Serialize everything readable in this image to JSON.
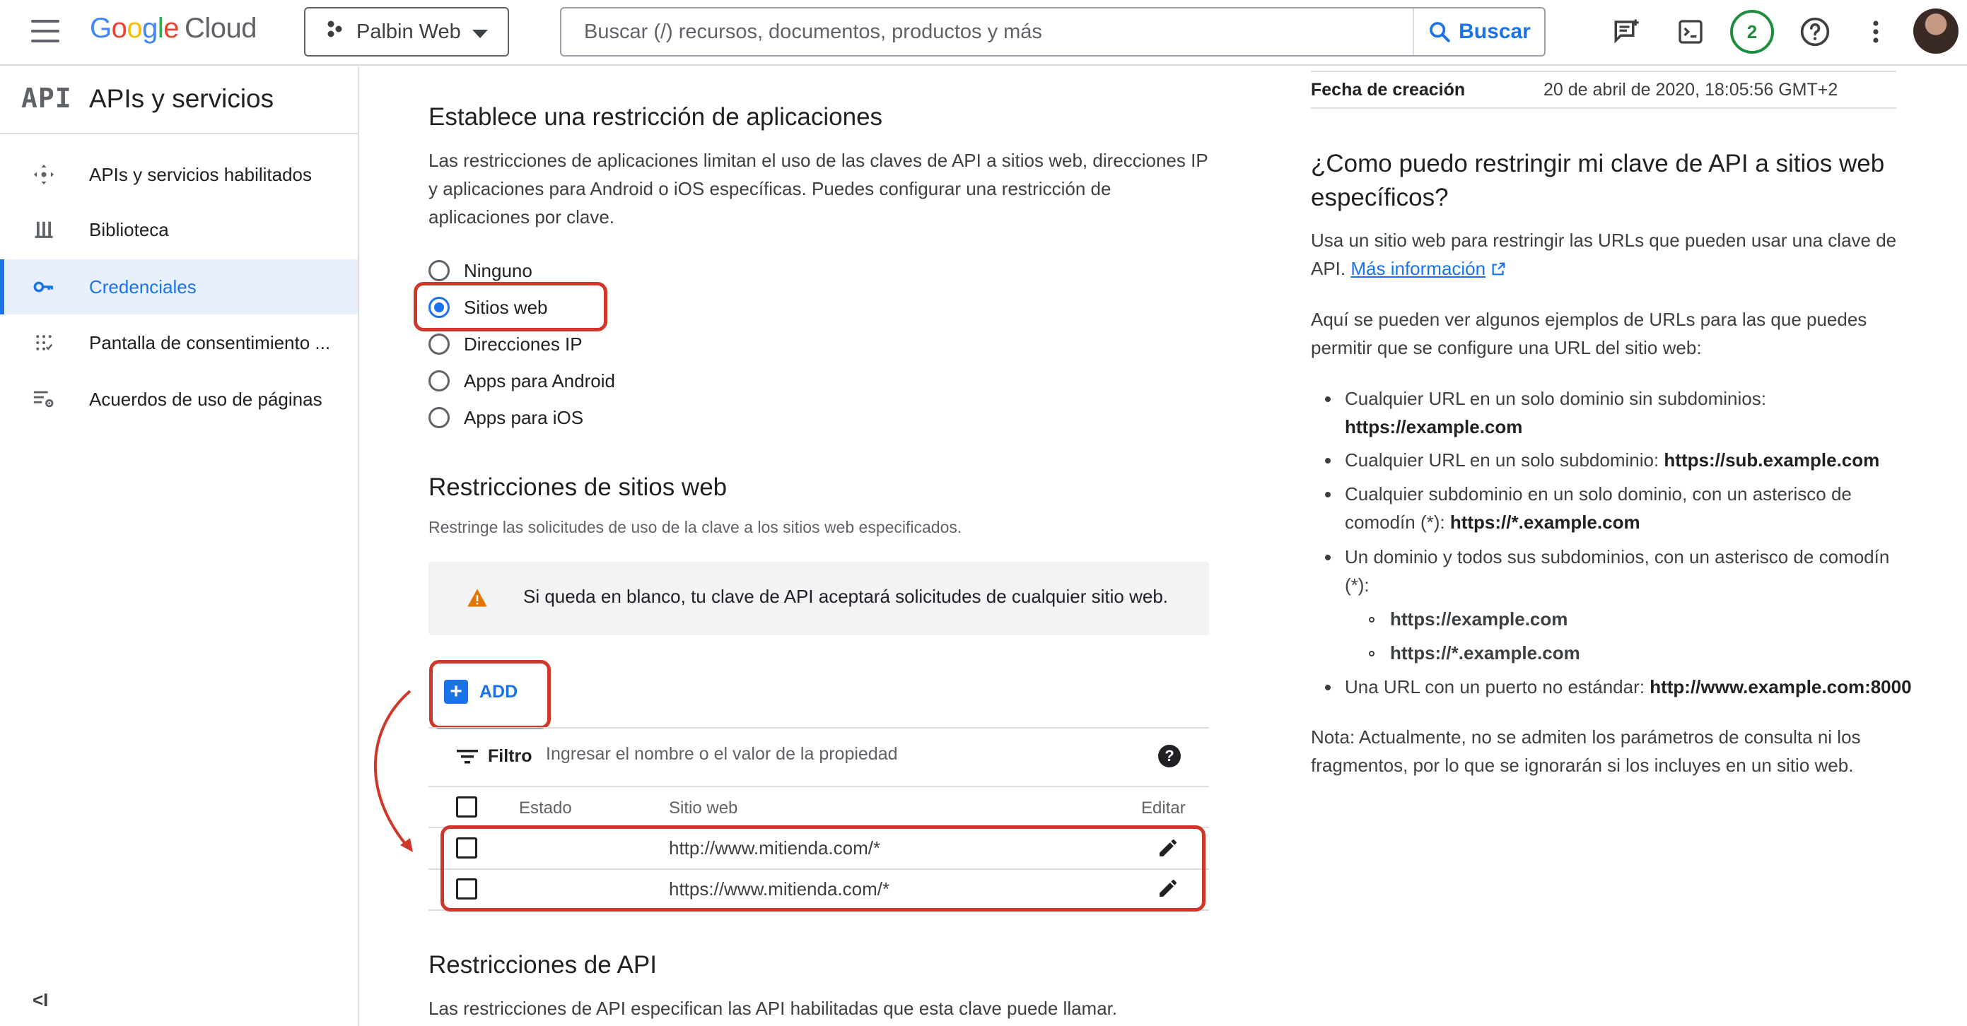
{
  "header": {
    "logo_google": "Google",
    "logo_cloud": "Cloud",
    "project": "Palbin Web",
    "search_placeholder": "Buscar (/) recursos, documentos, productos y más",
    "search_button": "Buscar",
    "notification_count": "2"
  },
  "sidebar": {
    "badge": "API",
    "title": "APIs y servicios",
    "items": [
      {
        "label": "APIs y servicios habilitados",
        "icon": "apis-hub-icon"
      },
      {
        "label": "Biblioteca",
        "icon": "library-icon"
      },
      {
        "label": "Credenciales",
        "icon": "key-icon",
        "active": true
      },
      {
        "label": "Pantalla de consentimiento ...",
        "icon": "consent-icon"
      },
      {
        "label": "Acuerdos de uso de páginas",
        "icon": "settings-list-icon"
      }
    ],
    "collapse": "<I"
  },
  "main": {
    "app_restriction_title": "Establece una restricción de aplicaciones",
    "app_restriction_desc": [
      "Las restricciones de aplicaciones limitan el uso de las claves de API a sitios web, direcciones IP",
      "y aplicaciones para Android o iOS específicas. Puedes configurar una restricción de",
      "aplicaciones por clave."
    ],
    "radio_options": [
      "Ninguno",
      "Sitios web",
      "Direcciones IP",
      "Apps para Android",
      "Apps para iOS"
    ],
    "selected_option": "Sitios web",
    "web_restrictions_title": "Restricciones de sitios web",
    "web_restrictions_desc": "Restringe las solicitudes de uso de la clave a los sitios web especificados.",
    "warning": "Si queda en blanco, tu clave de API aceptará solicitudes de cualquier sitio web.",
    "add_label": "ADD",
    "filter_label": "Filtro",
    "filter_placeholder": "Ingresar el nombre o el valor de la propiedad",
    "table": {
      "columns": [
        "Estado",
        "Sitio web",
        "Editar"
      ],
      "rows": [
        {
          "site": "http://www.mitienda.com/*"
        },
        {
          "site": "https://www.mitienda.com/*"
        }
      ]
    },
    "api_restrictions_title": "Restricciones de API",
    "api_restrictions_desc": "Las restricciones de API especifican las API habilitadas que esta clave puede llamar."
  },
  "right_panel": {
    "created_label": "Fecha de creación",
    "created_value": "20 de abril de 2020, 18:05:56 GMT+2",
    "help_title_1": "¿Como puedo restringir mi clave de API a sitios web",
    "help_title_2": "específicos?",
    "intro_1": "Usa un sitio web para restringir las URLs que pueden usar una clave de",
    "intro_2_prefix": "API. ",
    "more_info": "Más información",
    "examples_1": "Aquí se pueden ver algunos ejemplos de URLs para las que puedes",
    "examples_2": "permitir que se configure una URL del sitio web:",
    "list": {
      "i1_text": "Cualquier URL en un solo dominio sin subdominios:",
      "i1_url": "https://example.com",
      "i2_text": "Cualquier URL en un solo subdominio: ",
      "i2_url": "https://sub.example.com",
      "i3_text_1": "Cualquier subdominio en un solo dominio, con un asterisco de",
      "i3_text_2": "comodín (*): ",
      "i3_url": "https://*.example.com",
      "i4_text_1": "Un dominio y todos sus subdominios, con un asterisco de comodín",
      "i4_text_2": "(*):",
      "i4_sub1": "https://example.com",
      "i4_sub2": "https://*.example.com",
      "i5_text": "Una URL con un puerto no estándar: ",
      "i5_url": "http://www.example.com:8000"
    },
    "note_1": "Nota: Actualmente, no se admiten los parámetros de consulta ni los",
    "note_2": "fragmentos, por lo que se ignorarán si los incluyes en un sitio web."
  },
  "colors": {
    "accent": "#1a73e8",
    "annotation_red": "#d0362a",
    "warning": "#e37400",
    "badge_green": "#1e8e3e"
  }
}
